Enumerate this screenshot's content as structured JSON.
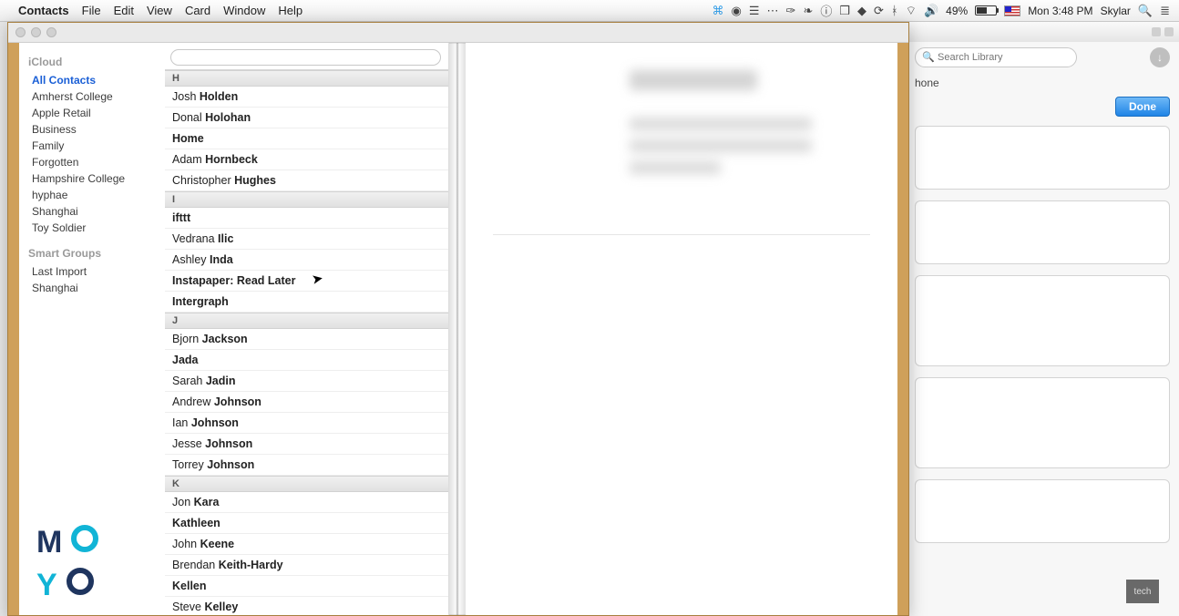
{
  "menubar": {
    "app_name": "Contacts",
    "items": [
      "File",
      "Edit",
      "View",
      "Card",
      "Window",
      "Help"
    ],
    "battery_pct": "49%",
    "clock": "Mon 3:48 PM",
    "user": "Skylar"
  },
  "bgwin": {
    "search_placeholder": "Search Library",
    "phone_label": "hone",
    "done_label": "Done",
    "tech_label": "tech"
  },
  "contacts": {
    "sidebar": {
      "section1_header": "iCloud",
      "groups": [
        {
          "label": "All Contacts",
          "selected": true
        },
        {
          "label": "Amherst College",
          "selected": false
        },
        {
          "label": "Apple Retail",
          "selected": false
        },
        {
          "label": "Business",
          "selected": false
        },
        {
          "label": "Family",
          "selected": false
        },
        {
          "label": "Forgotten",
          "selected": false
        },
        {
          "label": "Hampshire College",
          "selected": false
        },
        {
          "label": "hyphae",
          "selected": false
        },
        {
          "label": "Shanghai",
          "selected": false
        },
        {
          "label": "Toy Soldier",
          "selected": false
        }
      ],
      "section2_header": "Smart Groups",
      "smart_groups": [
        {
          "label": "Last Import"
        },
        {
          "label": "Shanghai"
        }
      ]
    },
    "search_placeholder": "",
    "sections": [
      {
        "letter": "H",
        "rows": [
          {
            "first": "Josh",
            "last": "Holden"
          },
          {
            "first": "Donal",
            "last": "Holohan"
          },
          {
            "first": "",
            "last": "Home"
          },
          {
            "first": "Adam",
            "last": "Hornbeck"
          },
          {
            "first": "Christopher",
            "last": "Hughes"
          }
        ]
      },
      {
        "letter": "I",
        "rows": [
          {
            "first": "",
            "last": "ifttt"
          },
          {
            "first": "Vedrana",
            "last": "Ilic"
          },
          {
            "first": "Ashley",
            "last": "Inda"
          },
          {
            "first": "",
            "last": "Instapaper: Read Later"
          },
          {
            "first": "",
            "last": "Intergraph"
          }
        ]
      },
      {
        "letter": "J",
        "rows": [
          {
            "first": "Bjorn",
            "last": "Jackson"
          },
          {
            "first": "",
            "last": "Jada"
          },
          {
            "first": "Sarah",
            "last": "Jadin"
          },
          {
            "first": "Andrew",
            "last": "Johnson"
          },
          {
            "first": "Ian",
            "last": "Johnson"
          },
          {
            "first": "Jesse",
            "last": "Johnson"
          },
          {
            "first": "Torrey",
            "last": "Johnson"
          }
        ]
      },
      {
        "letter": "K",
        "rows": [
          {
            "first": "Jon",
            "last": "Kara"
          },
          {
            "first": "",
            "last": "Kathleen"
          },
          {
            "first": "John",
            "last": "Keene"
          },
          {
            "first": "Brendan",
            "last": "Keith-Hardy"
          },
          {
            "first": "",
            "last": "Kellen"
          },
          {
            "first": "Steve",
            "last": "Kelley"
          }
        ]
      }
    ]
  },
  "watermark": {
    "line1a": "M",
    "line1b": "O",
    "line2a": "Y",
    "line2b": "O"
  }
}
